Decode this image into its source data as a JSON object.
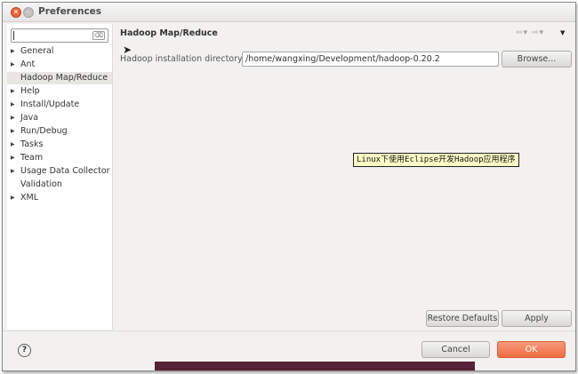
{
  "window": {
    "title": "Preferences"
  },
  "sidebar": {
    "filter_value": "",
    "items": [
      {
        "label": "General",
        "expandable": true
      },
      {
        "label": "Ant",
        "expandable": true
      },
      {
        "label": "Hadoop Map/Reduce",
        "expandable": false,
        "selected": true
      },
      {
        "label": "Help",
        "expandable": true
      },
      {
        "label": "Install/Update",
        "expandable": true
      },
      {
        "label": "Java",
        "expandable": true
      },
      {
        "label": "Run/Debug",
        "expandable": true
      },
      {
        "label": "Tasks",
        "expandable": true
      },
      {
        "label": "Team",
        "expandable": true
      },
      {
        "label": "Usage Data Collector",
        "expandable": true
      },
      {
        "label": "Validation",
        "expandable": false
      },
      {
        "label": "XML",
        "expandable": true
      }
    ]
  },
  "page": {
    "title": "Hadoop Map/Reduce",
    "field_label": "Hadoop installation directory:",
    "field_value": "/home/wangxing/Development/hadoop-0.20.2",
    "browse_label": "Browse...",
    "restore_label": "Restore Defaults",
    "apply_label": "Apply"
  },
  "footer": {
    "cancel_label": "Cancel",
    "ok_label": "OK"
  },
  "overlay": {
    "watermark": "Linux下使用Eclipse开发Hadoop应用程序"
  },
  "colors": {
    "close_button": "#e8633a",
    "ok_button": "#ef6c40",
    "selected_row": "#e7e6e3"
  }
}
